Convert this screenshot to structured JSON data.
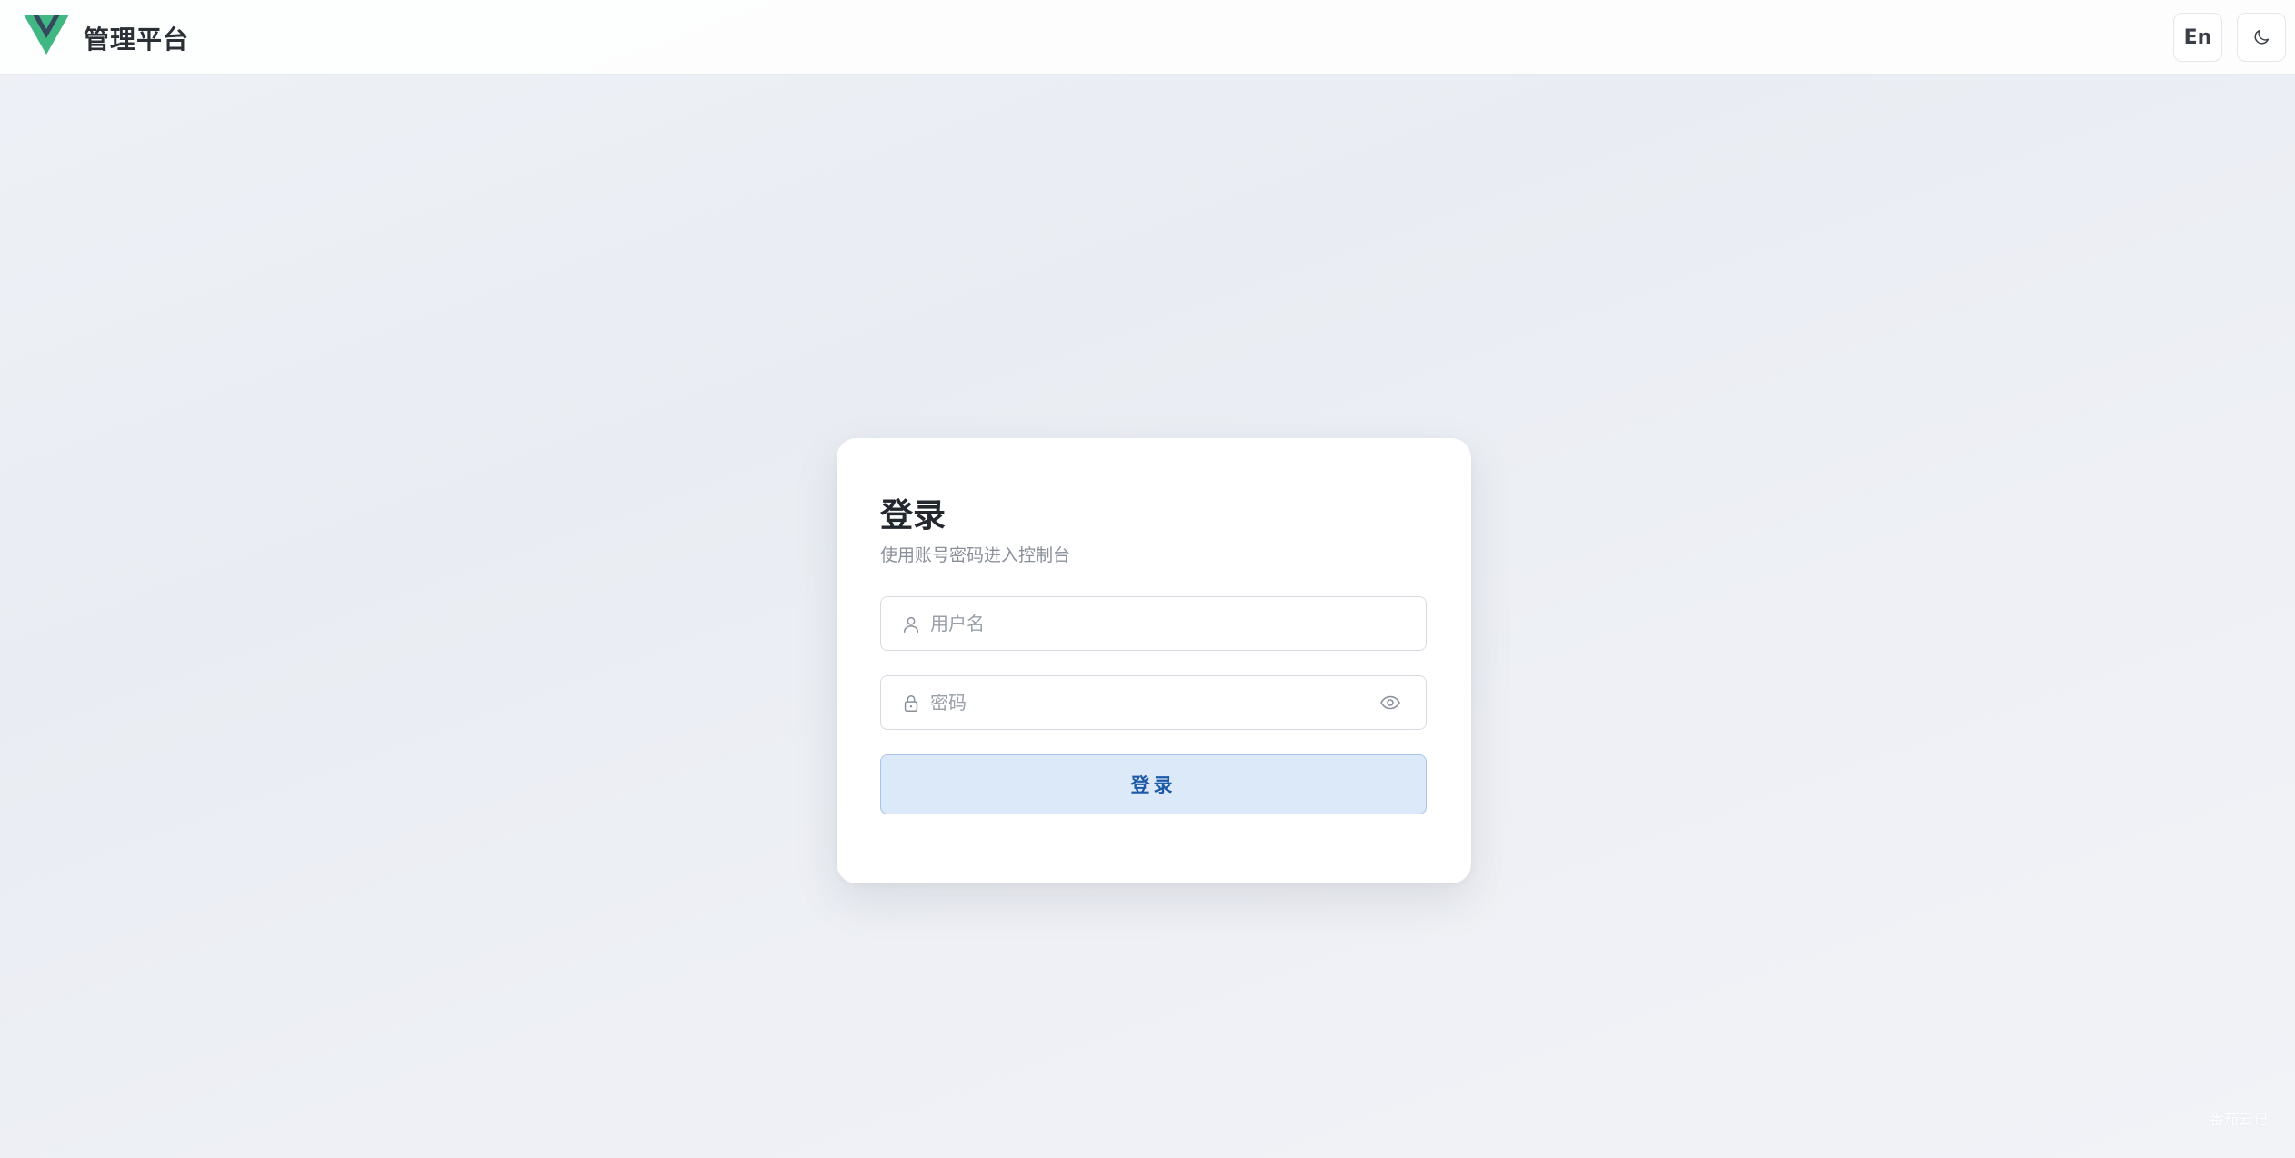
{
  "header": {
    "brand": "管理平台",
    "logo_icon": "vue-logo-icon",
    "lang_button": "En",
    "theme_icon": "moon-icon"
  },
  "login": {
    "title": "登录",
    "subtitle": "使用账号密码进入控制台",
    "username": {
      "placeholder": "用户名",
      "value": "",
      "icon": "user-icon"
    },
    "password": {
      "placeholder": "密码",
      "value": "",
      "icon": "lock-icon",
      "toggle_icon": "eye-icon"
    },
    "submit_label": "登录"
  },
  "watermark": "番茄云记",
  "colors": {
    "logo_green": "#41b883",
    "logo_dark": "#35495e",
    "button_bg": "#dce9f9",
    "button_text": "#1e5aa8"
  }
}
